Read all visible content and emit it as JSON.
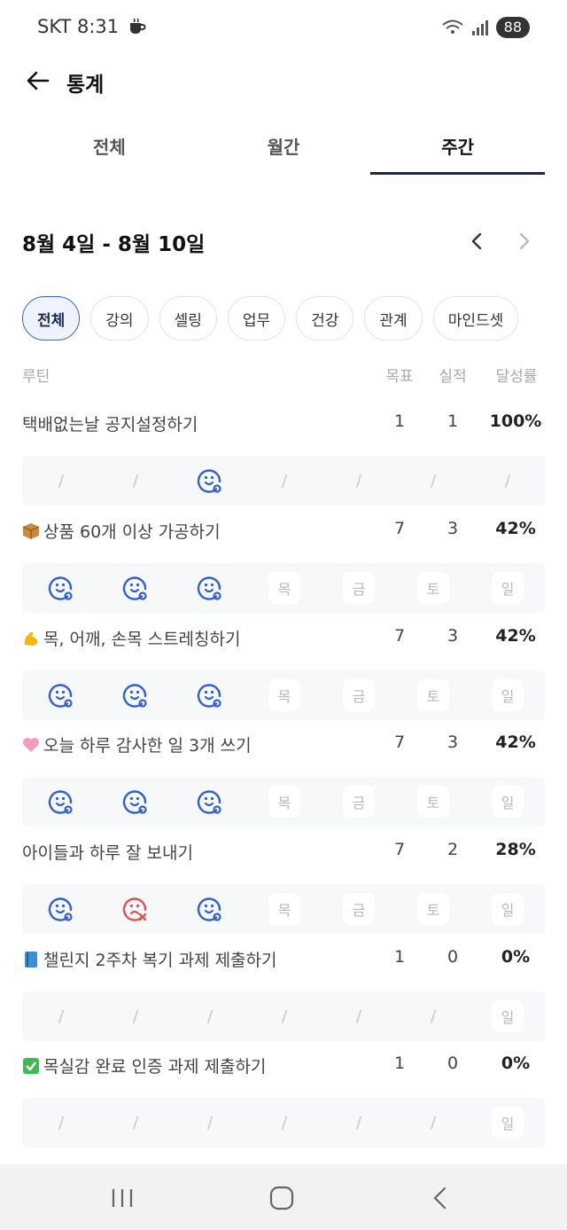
{
  "status": {
    "carrier": "SKT 8:31",
    "battery": "88"
  },
  "header": {
    "title": "통계"
  },
  "tabs": [
    {
      "label": "전체",
      "active": false
    },
    {
      "label": "월간",
      "active": false
    },
    {
      "label": "주간",
      "active": true
    }
  ],
  "week": {
    "range": "8월 4일 - 8월 10일"
  },
  "chips": [
    {
      "label": "전체",
      "active": true
    },
    {
      "label": "강의",
      "active": false
    },
    {
      "label": "셀링",
      "active": false
    },
    {
      "label": "업무",
      "active": false
    },
    {
      "label": "건강",
      "active": false
    },
    {
      "label": "관계",
      "active": false
    },
    {
      "label": "마인드셋",
      "active": false
    }
  ],
  "table": {
    "routine": "루틴",
    "goal": "목표",
    "actual": "실적",
    "rate": "달성률"
  },
  "routines": [
    {
      "emoji": "",
      "name": "택배없는날 공지설정하기",
      "goal": "1",
      "actual": "1",
      "rate": "100%",
      "days": [
        "/",
        "/",
        "done",
        "/",
        "/",
        "/",
        "/"
      ]
    },
    {
      "emoji": "box",
      "name": "상품 60개 이상 가공하기",
      "goal": "7",
      "actual": "3",
      "rate": "42%",
      "days": [
        "done",
        "done",
        "done",
        "목",
        "금",
        "토",
        "일"
      ]
    },
    {
      "emoji": "muscle",
      "name": "목, 어깨, 손목 스트레칭하기",
      "goal": "7",
      "actual": "3",
      "rate": "42%",
      "days": [
        "done",
        "done",
        "done",
        "목",
        "금",
        "토",
        "일"
      ]
    },
    {
      "emoji": "heart",
      "name": "오늘 하루 감사한 일 3개 쓰기",
      "goal": "7",
      "actual": "3",
      "rate": "42%",
      "days": [
        "done",
        "done",
        "done",
        "목",
        "금",
        "토",
        "일"
      ]
    },
    {
      "emoji": "",
      "name": "아이들과 하루 잘 보내기",
      "goal": "7",
      "actual": "2",
      "rate": "28%",
      "days": [
        "done",
        "fail",
        "done",
        "목",
        "금",
        "토",
        "일"
      ]
    },
    {
      "emoji": "book",
      "name": "챌린지 2주차 복기 과제 제출하기",
      "goal": "1",
      "actual": "0",
      "rate": "0%",
      "days": [
        "/",
        "/",
        "/",
        "/",
        "/",
        "/",
        "일"
      ]
    },
    {
      "emoji": "check",
      "name": "목실감 완료 인증 과제 제출하기",
      "goal": "1",
      "actual": "0",
      "rate": "0%",
      "days": [
        "/",
        "/",
        "/",
        "/",
        "/",
        "/",
        "일"
      ]
    }
  ],
  "colors": {
    "accent": "#2f5fd0",
    "fail": "#d9534f",
    "tabUnderline": "#1c2a3d"
  }
}
